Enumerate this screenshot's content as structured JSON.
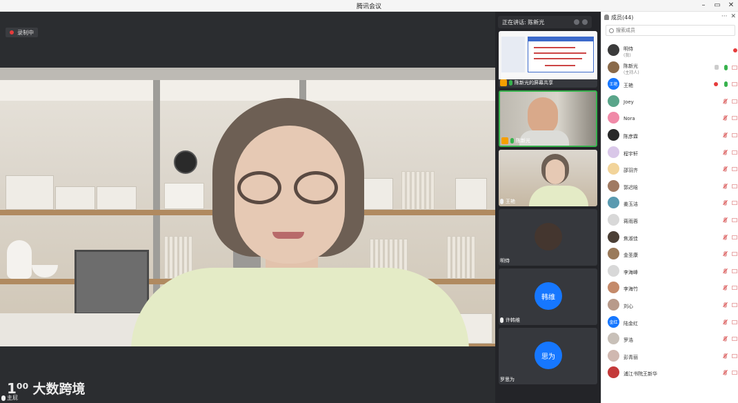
{
  "window": {
    "title": "腾讯会议"
  },
  "recording": {
    "label": "录制中"
  },
  "watermark": {
    "logo": "1⁰⁰",
    "text": "大数跨境"
  },
  "bottom_label": "主屁",
  "speaking": {
    "label": "正在讲话: 陈新光"
  },
  "thumbs": [
    {
      "name": "陈新光的屏幕共享",
      "kind": "screenshare"
    },
    {
      "name": "陈新光",
      "kind": "video",
      "active": true
    },
    {
      "name": "王艳",
      "kind": "video"
    },
    {
      "name": "明侍",
      "kind": "avatar"
    },
    {
      "name": "许韩维",
      "kind": "initials",
      "initials": "韩维"
    },
    {
      "name": "罗思为",
      "kind": "initials",
      "initials": "思为"
    }
  ],
  "panel": {
    "title": "成员(44)",
    "search_placeholder": "搜索成员",
    "members": [
      {
        "name": "明侍",
        "sub": "(我)",
        "avatar_color": "#3b3b3b",
        "state": "rec"
      },
      {
        "name": "陈新光",
        "sub": "(主持人)",
        "avatar_color": "#8a6a4a",
        "state": "host"
      },
      {
        "name": "王艳",
        "avatar_text": "王艳",
        "avatar_color": "#1677ff",
        "state": "presenter"
      },
      {
        "name": "Joey",
        "avatar_color": "#5aa58a",
        "state": "muted"
      },
      {
        "name": "Nora",
        "avatar_color": "#f08aa8",
        "state": "muted"
      },
      {
        "name": "陈彦霖",
        "avatar_color": "#2a2a2a",
        "state": "muted"
      },
      {
        "name": "程宇轩",
        "avatar_color": "#d9c7e8",
        "state": "muted"
      },
      {
        "name": "邵羽齐",
        "avatar_color": "#f2d49a",
        "state": "muted"
      },
      {
        "name": "郭迟晗",
        "avatar_color": "#a07a62",
        "state": "muted"
      },
      {
        "name": "姜玉洁",
        "avatar_color": "#5a9ab0",
        "state": "muted"
      },
      {
        "name": "蒋雨蓉",
        "avatar_color": "#d8d8d8",
        "state": "muted"
      },
      {
        "name": "焦淑佳",
        "avatar_color": "#4b3f35",
        "state": "muted"
      },
      {
        "name": "金圣康",
        "avatar_color": "#9a7a5a",
        "state": "muted"
      },
      {
        "name": "李海峰",
        "avatar_color": "#d8d8d8",
        "state": "muted"
      },
      {
        "name": "李海竹",
        "avatar_color": "#c48a6a",
        "state": "muted"
      },
      {
        "name": "刘心",
        "avatar_color": "#b89a8a",
        "state": "muted"
      },
      {
        "name": "陆金红",
        "avatar_text": "金红",
        "avatar_color": "#1677ff",
        "state": "muted"
      },
      {
        "name": "罗浩",
        "avatar_color": "#c8c0b8",
        "state": "muted"
      },
      {
        "name": "彭青丽",
        "avatar_color": "#d0b8b0",
        "state": "muted"
      },
      {
        "name": "浦江书院王新华",
        "avatar_color": "#c43a3a",
        "state": "muted"
      }
    ]
  },
  "colors": {
    "accent": "#1677ff",
    "record_red": "#e63b3b",
    "active_green": "#37b24d"
  },
  "icons": {
    "record": "record-dot-icon",
    "minimize": "minimize-icon",
    "maximize": "maximize-icon",
    "close": "close-icon",
    "search": "search-icon",
    "mic_muted": "mic-muted-icon",
    "camera_off": "camera-off-icon"
  }
}
